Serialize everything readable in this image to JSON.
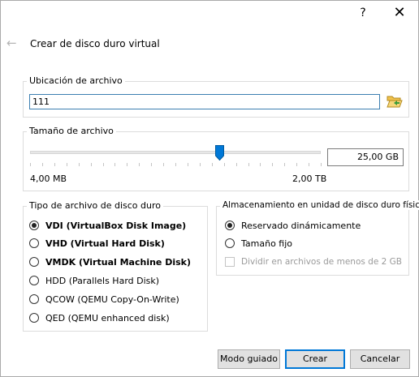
{
  "window": {
    "help_label": "?",
    "close_label": "✕",
    "back_icon": "arrow-left-icon",
    "dialog_title": "Crear de disco duro virtual"
  },
  "file_location": {
    "group_label": "Ubicación de archivo",
    "value": "111",
    "folder_icon": "folder-open-icon"
  },
  "file_size": {
    "group_label": "Tamaño de archivo",
    "value": "25,00 GB",
    "min_label": "4,00 MB",
    "max_label": "2,00 TB",
    "slider_fraction": 0.65
  },
  "file_type": {
    "group_label": "Tipo de archivo de disco duro",
    "options": [
      {
        "label": "VDI (VirtualBox Disk Image)",
        "checked": true,
        "bold": true
      },
      {
        "label": "VHD (Virtual Hard Disk)",
        "checked": false,
        "bold": true
      },
      {
        "label": "VMDK (Virtual Machine Disk)",
        "checked": false,
        "bold": true
      },
      {
        "label": "HDD (Parallels Hard Disk)",
        "checked": false,
        "bold": false
      },
      {
        "label": "QCOW (QEMU Copy-On-Write)",
        "checked": false,
        "bold": false
      },
      {
        "label": "QED (QEMU enhanced disk)",
        "checked": false,
        "bold": false
      }
    ]
  },
  "storage": {
    "group_label": "Almacenamiento en unidad de disco duro física",
    "dynamic_label": "Reservado dinámicamente",
    "fixed_label": "Tamaño fijo",
    "split_label": "Dividir en archivos de menos de 2 GB"
  },
  "buttons": {
    "guided": "Modo guiado",
    "create": "Crear",
    "cancel": "Cancelar"
  }
}
